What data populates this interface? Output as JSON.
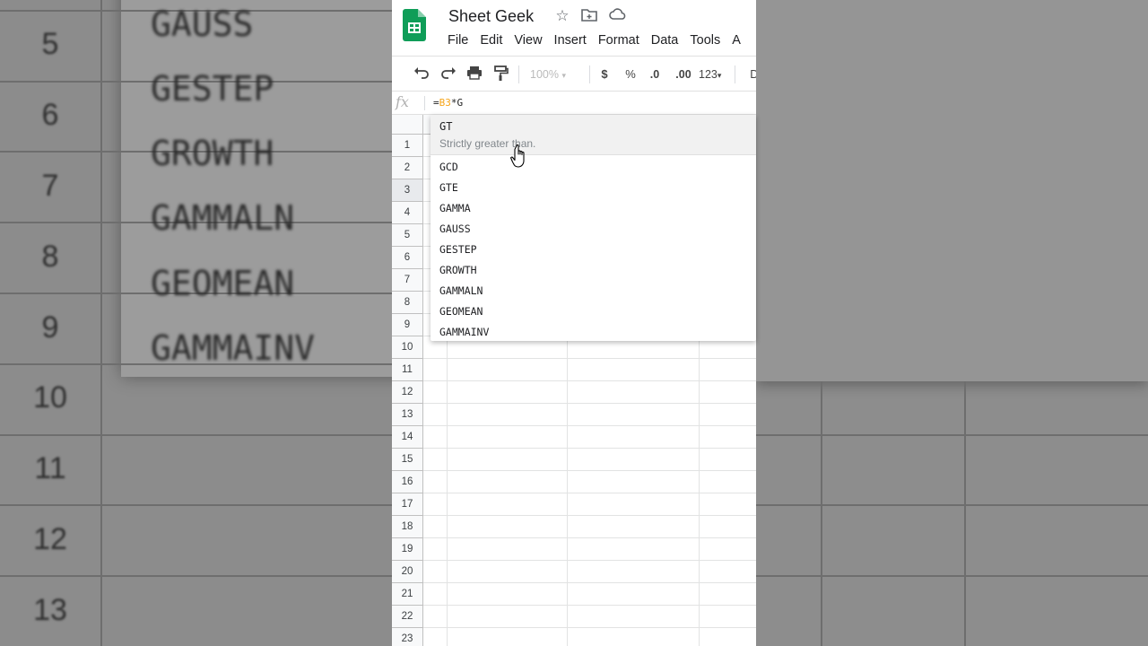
{
  "app": {
    "doc_title": "Sheet Geek",
    "menu": [
      "File",
      "Edit",
      "View",
      "Insert",
      "Format",
      "Data",
      "Tools",
      "A"
    ]
  },
  "toolbar": {
    "zoom": "100%",
    "currency": "$",
    "percent": "%",
    "decrease_decimal": ".0",
    "increase_decimal": ".00",
    "more_formats": "123",
    "more": "D"
  },
  "formula_bar": {
    "fx": "fx",
    "prefix": "=",
    "ref": "B3",
    "suffix": "*G"
  },
  "grid": {
    "rows": [
      "1",
      "2",
      "3",
      "4",
      "5",
      "6",
      "7",
      "8",
      "9",
      "10",
      "11",
      "12",
      "13",
      "14",
      "15",
      "16",
      "17",
      "18",
      "19",
      "20",
      "21",
      "22",
      "23"
    ],
    "selected_row": "3"
  },
  "autocomplete": {
    "highlighted": {
      "name": "GT",
      "description": "Strictly greater than."
    },
    "items": [
      "GCD",
      "GTE",
      "GAMMA",
      "GAUSS",
      "GESTEP",
      "GROWTH",
      "GAMMALN",
      "GEOMEAN",
      "GAMMAINV"
    ]
  },
  "background_zoom": {
    "row_numbers": [
      "5",
      "6",
      "7",
      "8",
      "9",
      "10",
      "11",
      "12",
      "13"
    ],
    "function_names": [
      "GAUSS",
      "GESTEP",
      "GROWTH",
      "GAMMALN",
      "GEOMEAN",
      "GAMMAINV"
    ]
  },
  "colors": {
    "sheets_green": "#0f9d58",
    "selection_blue": "#1a73e8",
    "ref_orange": "#f6a51a"
  }
}
